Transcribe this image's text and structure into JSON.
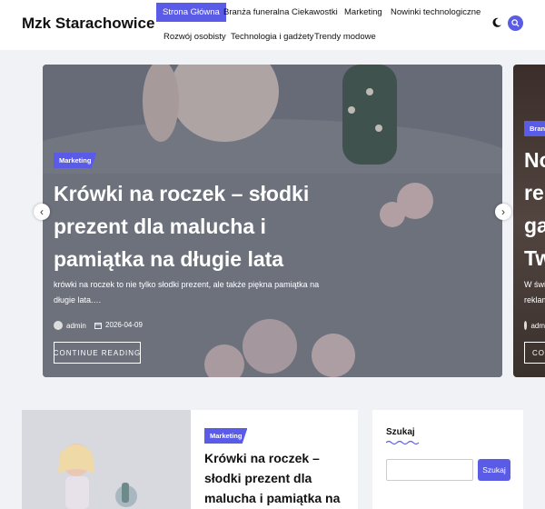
{
  "header": {
    "site_title": "Mzk Starachowice",
    "nav": [
      {
        "label": "Strona Główna",
        "active": true
      },
      {
        "label": "Branża funeralna"
      },
      {
        "label": "Ciekawostki"
      },
      {
        "label": "Marketing"
      },
      {
        "label": "Nowinki technologiczne"
      },
      {
        "label": "Rozwój osobisty"
      },
      {
        "label": "Technologia i gadżety"
      },
      {
        "label": "Trendy modowe"
      }
    ],
    "theme_icon": "moon-icon",
    "search_icon": "search-icon"
  },
  "slider": {
    "main": {
      "category": "Marketing",
      "title": "Krówki na roczek – słodki prezent dla malucha i pamiątka na długie lata",
      "excerpt": "krówki na roczek to nie tylko słodki prezent, ale także piękna pamiątka na długie lata.…",
      "author": "admin",
      "date": "2026-04-09",
      "button": "CONTINUE READING"
    },
    "next": {
      "category": "Branża",
      "title_lines": [
        "No",
        "rek",
        "gad",
        "Tw"
      ],
      "excerpt_lines": [
        "W świ",
        "reklam"
      ],
      "author": "adm",
      "button": "CON"
    },
    "prev_icon": "chevron-left-icon",
    "next_icon": "chevron-right-icon"
  },
  "post_card": {
    "category": "Marketing",
    "title": "Krówki na roczek – słodki prezent dla malucha i pamiątka na długie lata"
  },
  "widget": {
    "title": "Szukaj",
    "button": "Szukaj",
    "input_value": ""
  },
  "colors": {
    "accent": "#5a5be6",
    "background": "#f1f2f6"
  }
}
